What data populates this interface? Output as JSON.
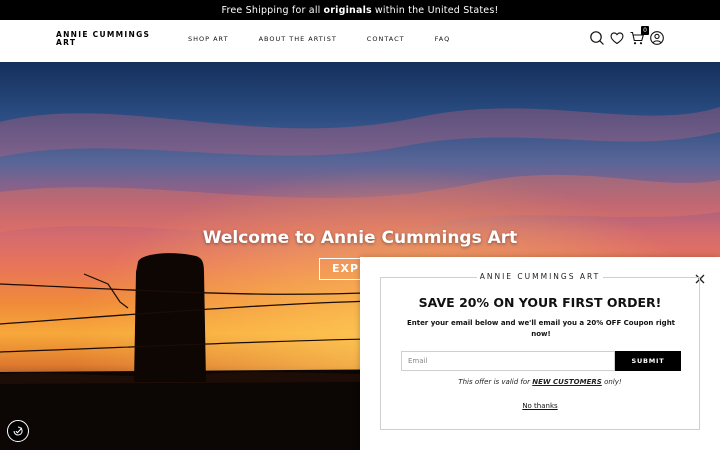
{
  "announcement": {
    "prefix": "Free Shipping for all",
    "bold": "originals",
    "suffix": "within the United States!"
  },
  "header": {
    "logo": "ANNIE CUMMINGS ART",
    "nav": [
      "SHOP ART",
      "ABOUT THE ARTIST",
      "CONTACT",
      "FAQ"
    ],
    "icons": [
      "search-icon",
      "heart-icon",
      "cart-icon",
      "account-icon"
    ],
    "cart_count": "0"
  },
  "hero": {
    "title": "Welcome to Annie Cummings Art",
    "button": "EXPLORE"
  },
  "popup": {
    "brand": "ANNIE CUMMINGS ART",
    "heading": "SAVE 20% ON YOUR FIRST ORDER!",
    "subtext": "Enter your email below and we'll email you a 20% OFF Coupon right now!",
    "email_placeholder": "Email",
    "email_value": "",
    "submit": "SUBMIT",
    "offer_prefix": "This offer is valid for",
    "offer_bold": "NEW CUSTOMERS",
    "offer_suffix": "only!",
    "no_thanks": "No thanks"
  },
  "colors": {
    "announcement_bg": "#000000",
    "button_bg": "#000000"
  }
}
